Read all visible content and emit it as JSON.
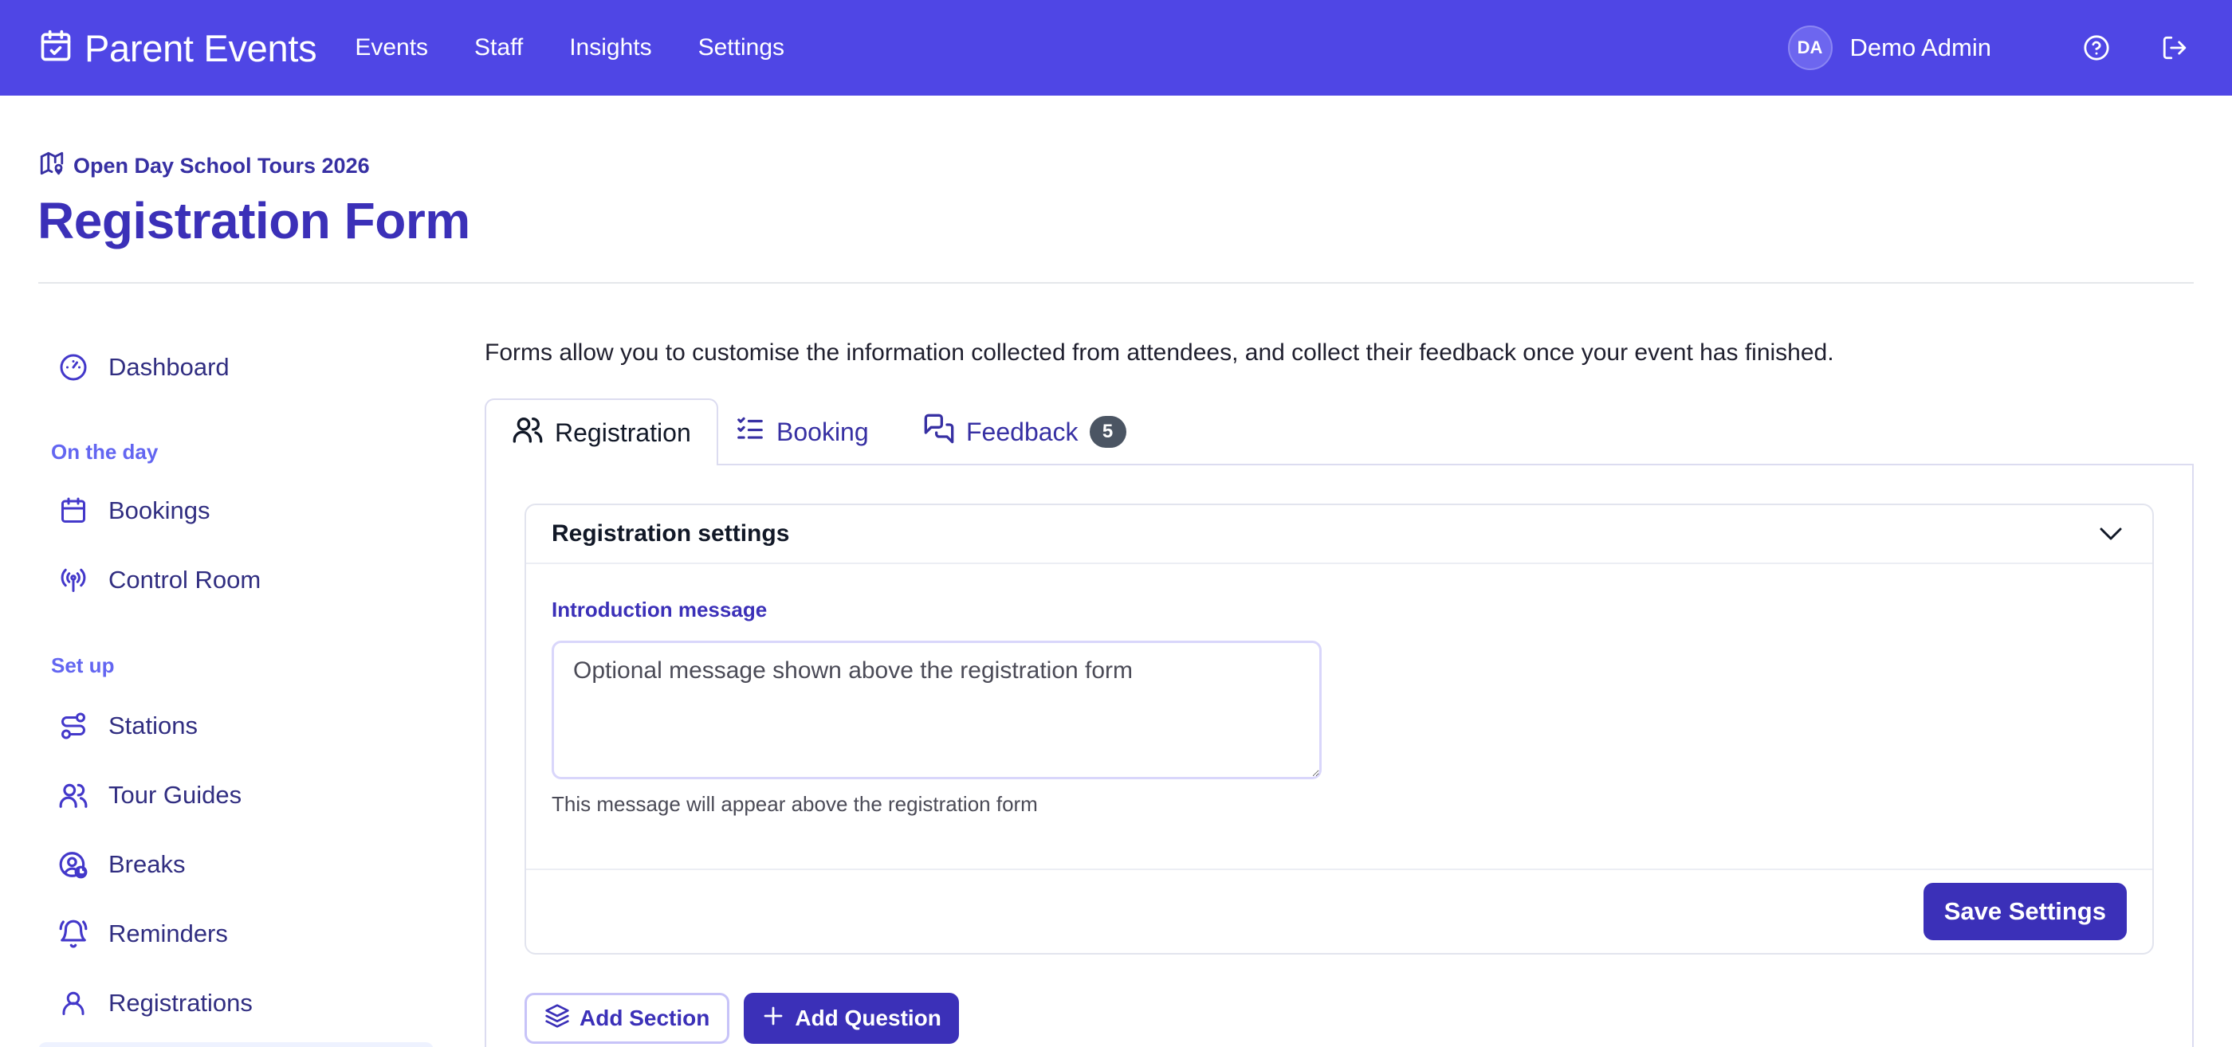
{
  "app": {
    "brand": "Parent Events",
    "nav": [
      "Events",
      "Staff",
      "Insights",
      "Settings"
    ],
    "user": {
      "initials": "DA",
      "name": "Demo Admin"
    },
    "icons": {
      "brand": "calendar-check-icon",
      "help": "help-circle-icon",
      "logout": "logout-icon"
    }
  },
  "header": {
    "event_name": "Open Day School Tours 2026",
    "title": "Registration Form"
  },
  "sidebar": {
    "dashboard": "Dashboard",
    "section_on_the_day": "On the day",
    "bookings": "Bookings",
    "control_room": "Control Room",
    "section_set_up": "Set up",
    "stations": "Stations",
    "tour_guides": "Tour Guides",
    "breaks": "Breaks",
    "reminders": "Reminders",
    "registrations": "Registrations"
  },
  "main": {
    "intro": "Forms allow you to customise the information collected from attendees, and collect their feedback once your event has finished.",
    "tabs": {
      "registration": "Registration",
      "booking": "Booking",
      "feedback": "Feedback",
      "feedback_count": "5"
    },
    "settings_card": {
      "title": "Registration settings",
      "intro_label": "Introduction message",
      "intro_placeholder": "Optional message shown above the registration form",
      "help": "This message will appear above the registration form",
      "save": "Save Settings"
    },
    "actions": {
      "add_section": "Add Section",
      "add_question": "Add Question"
    }
  },
  "colors": {
    "brand": "#4f46e5",
    "primary": "#3b30b8",
    "badge": "#4b5563"
  }
}
